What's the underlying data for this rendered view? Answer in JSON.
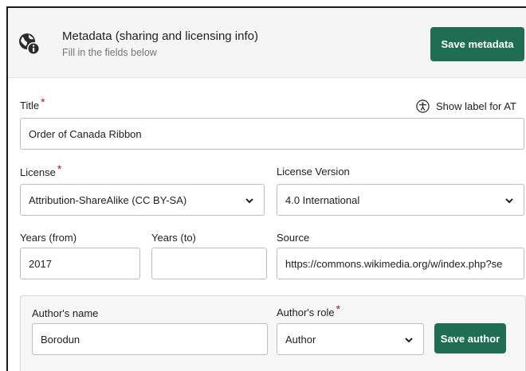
{
  "header": {
    "icon": "globe-info-icon",
    "title": "Metadata (sharing and licensing info)",
    "subtitle": "Fill in the fields below",
    "save_button": "Save metadata"
  },
  "accessibility": {
    "icon": "accessibility-icon",
    "show_label": "Show label for AT"
  },
  "form": {
    "title": {
      "label": "Title",
      "required": "*",
      "value": "Order of Canada Ribbon"
    },
    "license": {
      "label": "License",
      "required": "*",
      "value": "Attribution-ShareAlike (CC BY-SA)"
    },
    "license_version": {
      "label": "License Version",
      "value": "4.0 International"
    },
    "years_from": {
      "label": "Years (from)",
      "value": "2017"
    },
    "years_to": {
      "label": "Years (to)",
      "value": ""
    },
    "source": {
      "label": "Source",
      "value": "https://commons.wikimedia.org/w/index.php?se"
    }
  },
  "author": {
    "name_label": "Author's name",
    "name_value": "Borodun",
    "role_label": "Author's role",
    "role_required": "*",
    "role_value": "Author",
    "save_button": "Save author"
  },
  "colors": {
    "primary_button": "#1f6e54",
    "required": "#c8102e",
    "header_bg": "#f5f5f5"
  }
}
